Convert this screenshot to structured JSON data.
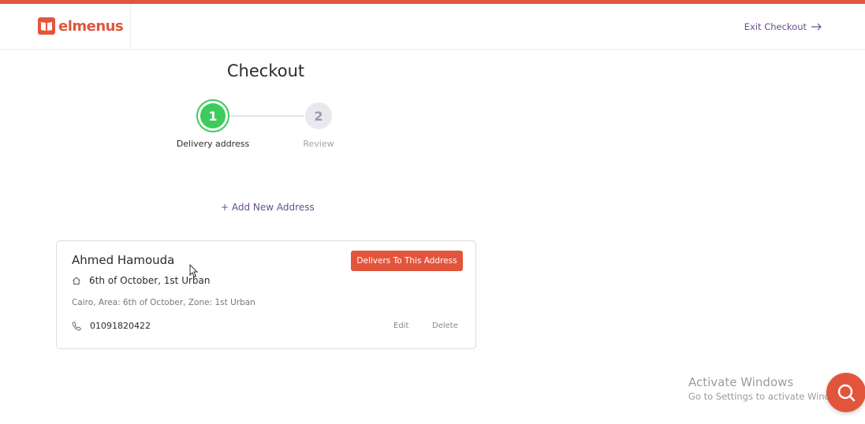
{
  "header": {
    "logo_text": "elmenus",
    "exit_label": "Exit Checkout"
  },
  "page": {
    "title": "Checkout"
  },
  "stepper": {
    "steps": [
      {
        "number": "1",
        "label": "Delivery address",
        "state": "active"
      },
      {
        "number": "2",
        "label": "Review",
        "state": "inactive"
      }
    ]
  },
  "actions": {
    "add_address": "+ Add New Address"
  },
  "address_card": {
    "name": "Ahmed Hamouda",
    "address_line": "6th of October, 1st Urban",
    "address_detail": "Cairo, Area: 6th of October, Zone: 1st Urban",
    "phone": "01091820422",
    "deliver_button": "Delivers To This Address",
    "edit_label": "Edit",
    "delete_label": "Delete"
  },
  "watermark": {
    "title": "Activate Windows",
    "subtitle": "Go to Settings to activate Windows."
  },
  "colors": {
    "brand": "#e2553d",
    "accent_purple": "#6a4c93",
    "step_active": "#3fcb5b"
  },
  "icons": [
    "home-icon",
    "phone-icon",
    "arrow-right-icon",
    "search-chat-icon",
    "logo-book-icon"
  ]
}
